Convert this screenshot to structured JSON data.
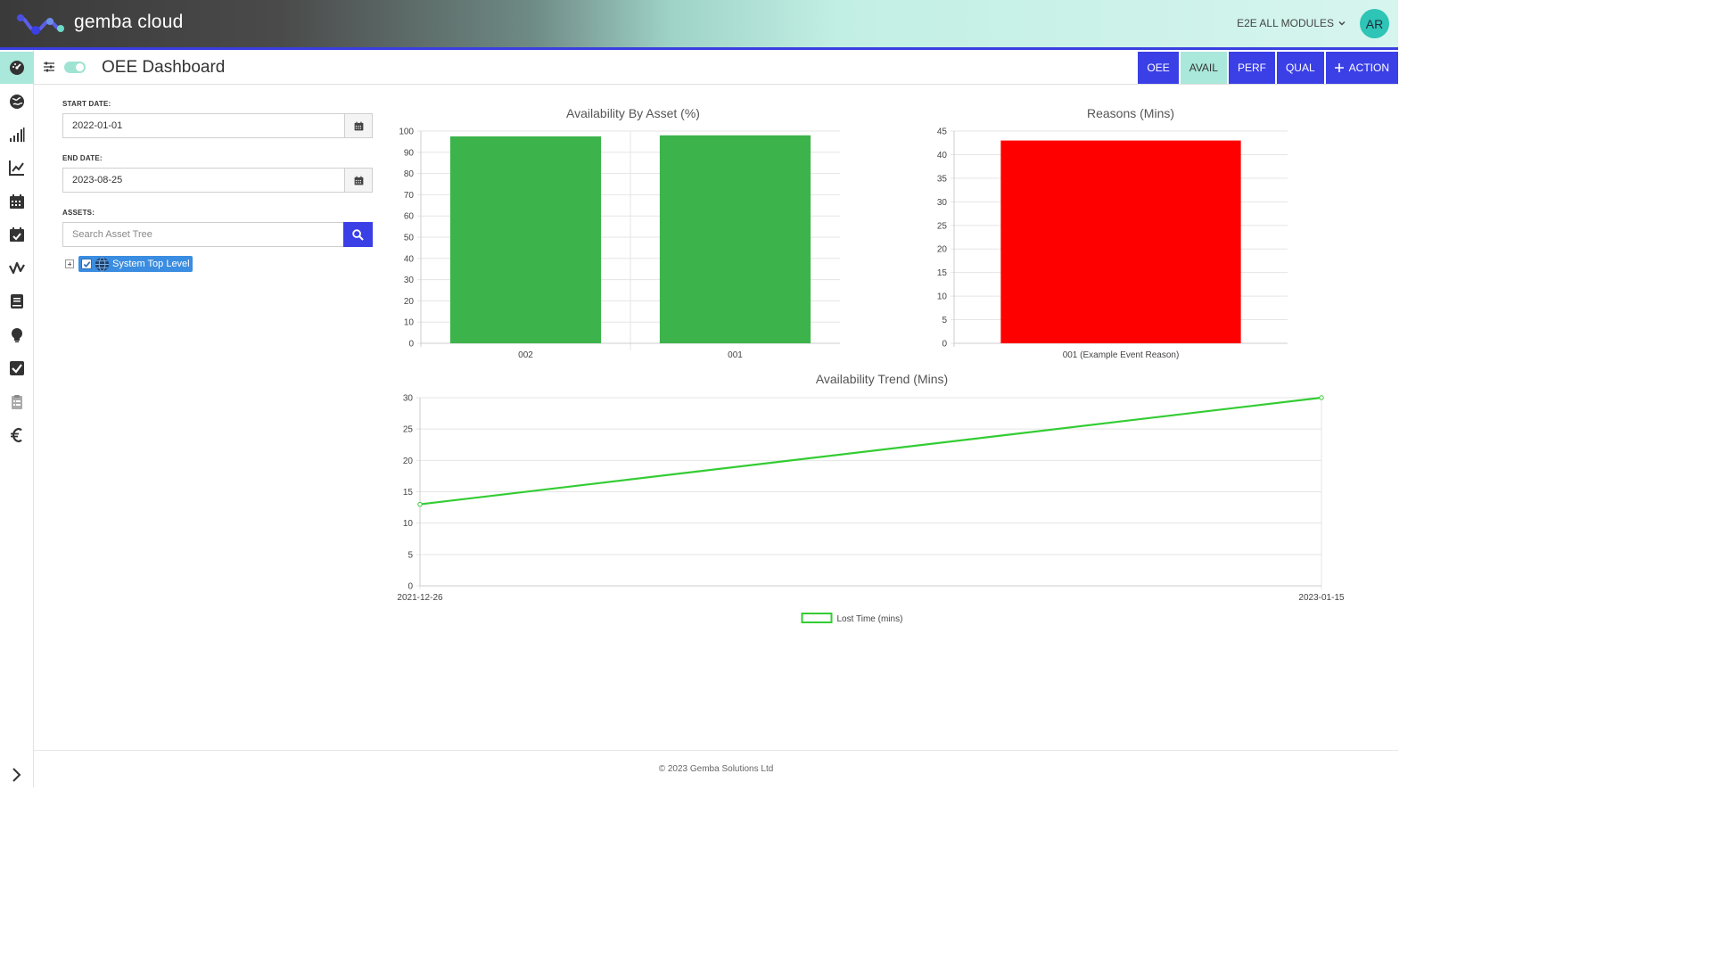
{
  "app": {
    "brand": "gemba cloud",
    "module_selector": "E2E ALL MODULES",
    "avatar_initials": "AR"
  },
  "header": {
    "title": "OEE Dashboard",
    "tabs": [
      {
        "label": "OEE",
        "active": false
      },
      {
        "label": "AVAIL",
        "active": true
      },
      {
        "label": "PERF",
        "active": false
      },
      {
        "label": "QUAL",
        "active": false
      }
    ],
    "action_label": "ACTION"
  },
  "form": {
    "start_label": "START DATE:",
    "start_value": "2022-01-01",
    "end_label": "END DATE:",
    "end_value": "2023-08-25",
    "assets_label": "ASSETS:",
    "search_placeholder": "Search Asset Tree",
    "tree_root": "System Top Level"
  },
  "sidebar": {
    "icons": [
      "dashboard-icon",
      "globe-icon",
      "signal-bars-icon",
      "line-chart-icon",
      "calendar-icon",
      "calendar-check-icon",
      "waveform-icon",
      "book-icon",
      "lightbulb-icon",
      "checkbox-icon",
      "clipboard-icon",
      "euro-icon"
    ],
    "active_index": 0
  },
  "colors": {
    "accent": "#3a3fe6",
    "active_tab": "#a9e8da",
    "bar_green": "#3cb44b",
    "bar_red": "#ff0000",
    "line_green": "#33cc33"
  },
  "footer": {
    "copyright": "© 2023 Gemba Solutions Ltd"
  },
  "chart_data": [
    {
      "id": "availability-by-asset",
      "type": "bar",
      "title": "Availability By Asset (%)",
      "categories": [
        "002",
        "001"
      ],
      "values": [
        97.5,
        98
      ],
      "ylim": [
        0,
        100
      ],
      "yticks": [
        0,
        10,
        20,
        30,
        40,
        50,
        60,
        70,
        80,
        90,
        100
      ],
      "color": "#3cb44b",
      "grid": true
    },
    {
      "id": "reasons-mins",
      "type": "bar",
      "title": "Reasons (Mins)",
      "categories": [
        "001 (Example Event Reason)"
      ],
      "values": [
        43
      ],
      "ylim": [
        0,
        45
      ],
      "yticks": [
        0,
        5,
        10,
        15,
        20,
        25,
        30,
        35,
        40,
        45
      ],
      "color": "#ff0000",
      "grid": true
    },
    {
      "id": "availability-trend",
      "type": "line",
      "title": "Availability Trend (Mins)",
      "x": [
        "2021-12-26",
        "2023-01-15"
      ],
      "series": [
        {
          "name": "Lost Time (mins)",
          "values": [
            13,
            30
          ]
        }
      ],
      "ylim": [
        0,
        30
      ],
      "yticks": [
        0,
        5,
        10,
        15,
        20,
        25,
        30
      ],
      "color": "#33cc33",
      "legend": "bottom",
      "grid": true
    }
  ]
}
